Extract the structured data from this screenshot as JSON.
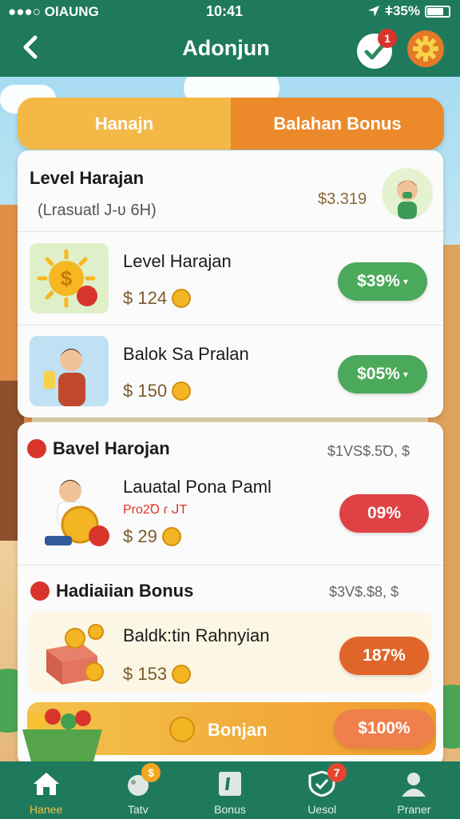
{
  "status_bar": {
    "carrier": "●●●○ OlAUNG",
    "time": "10:41",
    "battery": "ǂ35%"
  },
  "header": {
    "title": "Adonjun",
    "notification_count": "1"
  },
  "tabs": [
    {
      "label": "Hanajn",
      "active": true
    },
    {
      "label": "Balahan Bonus",
      "active": false
    }
  ],
  "card1": {
    "title": "Level Harajan",
    "subtitle": "(Lrasuatl J-ʋ 6H)",
    "amount": "$3.319",
    "rows": [
      {
        "label": "Level Harajan",
        "price": "$ 124",
        "pill": "$39%",
        "pill_color": "#4aa95a"
      },
      {
        "label": "Balok Sa Pralan",
        "price": "$ 150",
        "pill": "$05%",
        "pill_color": "#4aa95a"
      }
    ]
  },
  "card2": {
    "section1": {
      "title": "Bavel Harojan",
      "amount": "$1VS$.5Ꝺ, $",
      "row": {
        "label": "Lauatal Pona Paml",
        "sub": "Pro2Ꝺ ɾ ᒍT",
        "price": "$ 29",
        "pill": "09%",
        "pill_color": "#df4244"
      }
    },
    "section2": {
      "title": "Hadiaiian Bonus",
      "amount": "$3V$.$8, $",
      "row": {
        "label": "Baldk:tin Rahnyian",
        "price": "$ 153",
        "pill": "187%",
        "pill_color": "#e0652a"
      }
    },
    "banner": {
      "label": "Bonjan",
      "pill": "$100%",
      "pill_color": "#ef7f4b"
    }
  },
  "bottom_nav": [
    {
      "label": "Hanee",
      "icon": "home-icon",
      "active": true,
      "badge": ""
    },
    {
      "label": "Tatv",
      "icon": "gift-icon",
      "active": false,
      "badge": "$"
    },
    {
      "label": "Bonus",
      "icon": "bonus-card-icon",
      "active": false,
      "badge": ""
    },
    {
      "label": "Uesol",
      "icon": "shield-check-icon",
      "active": false,
      "badge": "7"
    },
    {
      "label": "Praner",
      "icon": "profile-icon",
      "active": false,
      "badge": ""
    }
  ],
  "colors": {
    "header": "#1f7a5d",
    "tab_active": "#f4b846",
    "tab_inactive": "#ec8a2b",
    "accent_green": "#4aa95a",
    "accent_red": "#df4244"
  }
}
